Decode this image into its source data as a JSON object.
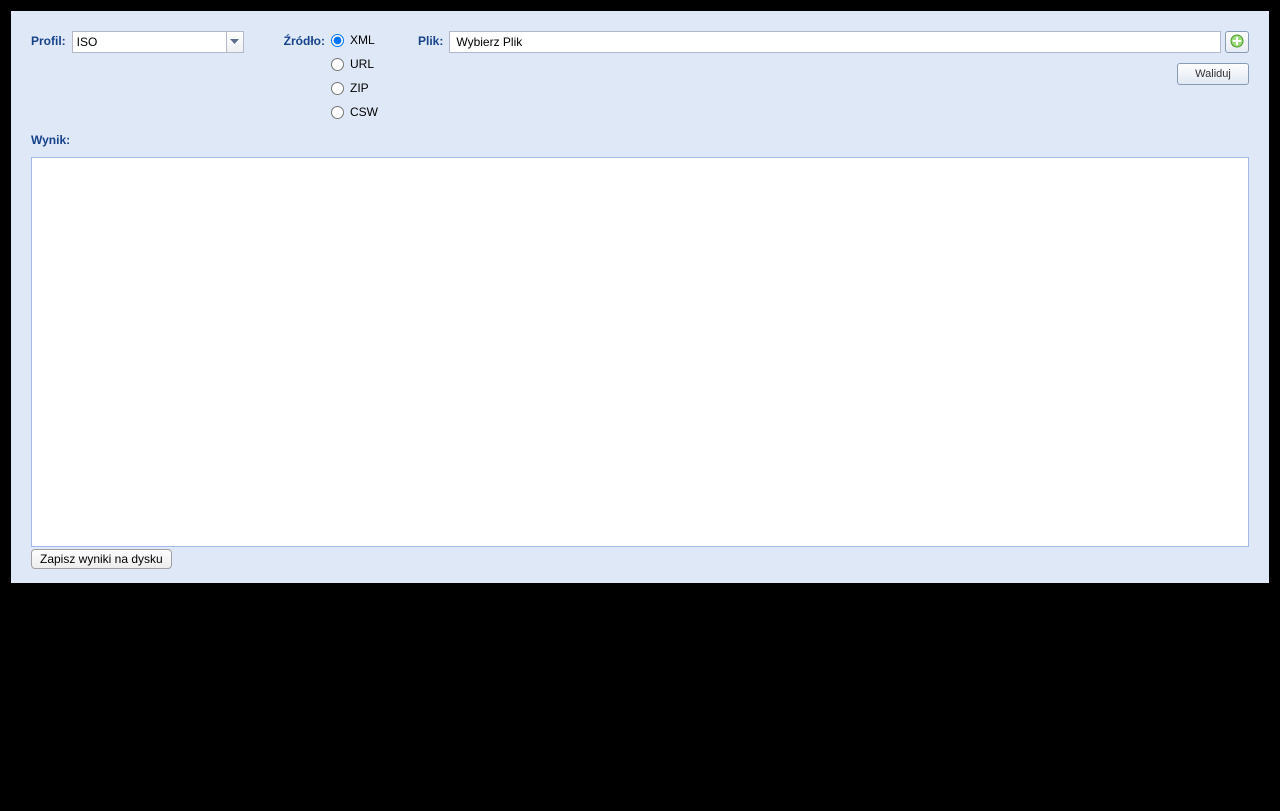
{
  "profile": {
    "label": "Profil:",
    "value": "ISO"
  },
  "source": {
    "label": "Źródło:",
    "options": [
      {
        "label": "XML",
        "value": "xml",
        "checked": true
      },
      {
        "label": "URL",
        "value": "url",
        "checked": false
      },
      {
        "label": "ZIP",
        "value": "zip",
        "checked": false
      },
      {
        "label": "CSW",
        "value": "csw",
        "checked": false
      }
    ]
  },
  "file": {
    "label": "Plik:",
    "value": "Wybierz Plik"
  },
  "validate_button": "Waliduj",
  "result": {
    "label": "Wynik:",
    "content": ""
  },
  "save_button": "Zapisz wyniki na dysku"
}
